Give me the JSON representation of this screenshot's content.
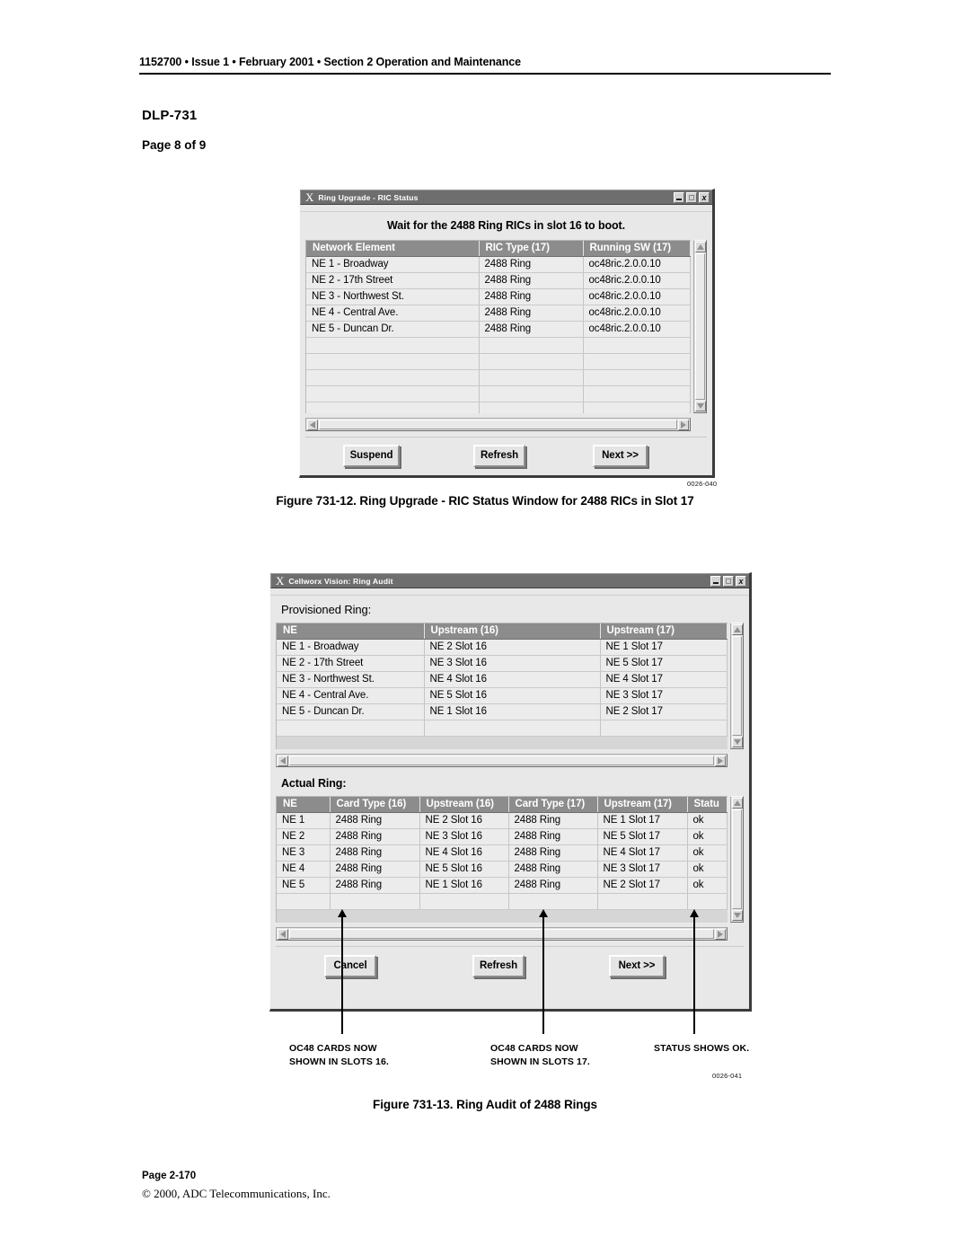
{
  "page": {
    "header": "1152700 • Issue 1 • February 2001 • Section 2 Operation and Maintenance",
    "dlp_title": "DLP-731",
    "dlp_page": "Page 8 of 9",
    "footer_page": "Page 2-170",
    "footer_copyright": "© 2000, ADC Telecommunications, Inc."
  },
  "figure1": {
    "id": "0026-040",
    "caption": "Figure 731-12. Ring Upgrade - RIC Status Window for 2488 RICs in Slot 17",
    "window": {
      "title": "Ring Upgrade - RIC Status",
      "title_icon": "X",
      "controls": {
        "minimize": "minimize-icon",
        "maximize": "maximize-icon",
        "close": "x"
      },
      "notice": "Wait for the 2488 Ring RICs in slot 16 to boot.",
      "table": {
        "columns": [
          "Network Element",
          "RIC Type (17)",
          "Running SW (17)"
        ],
        "rows": [
          [
            "NE 1 - Broadway",
            "2488 Ring",
            "oc48ric.2.0.0.10"
          ],
          [
            "NE 2 - 17th Street",
            "2488 Ring",
            "oc48ric.2.0.0.10"
          ],
          [
            "NE 3 - Northwest St.",
            "2488 Ring",
            "oc48ric.2.0.0.10"
          ],
          [
            "NE 4 - Central Ave.",
            "2488 Ring",
            "oc48ric.2.0.0.10"
          ],
          [
            "NE 5 - Duncan Dr.",
            "2488 Ring",
            "oc48ric.2.0.0.10"
          ]
        ],
        "empty_rows": 5
      },
      "buttons": {
        "suspend": "Suspend",
        "refresh": "Refresh",
        "next": "Next >>"
      }
    }
  },
  "figure2": {
    "id": "0026-041",
    "caption": "Figure 731-13. Ring Audit of 2488 Rings",
    "window": {
      "title": "Cellworx Vision: Ring Audit",
      "title_icon": "X",
      "controls": {
        "minimize": "minimize-icon",
        "maximize": "maximize-icon",
        "close": "x"
      },
      "provisioned_label": "Provisioned Ring:",
      "provisioned_table": {
        "columns": [
          "NE",
          "Upstream (16)",
          "Upstream (17)"
        ],
        "rows": [
          [
            "NE 1 - Broadway",
            "NE 2 Slot 16",
            "NE 1 Slot 17"
          ],
          [
            "NE 2 - 17th Street",
            "NE 3 Slot 16",
            "NE 5  Slot 17"
          ],
          [
            "NE 3 - Northwest St.",
            "NE 4 Slot 16",
            "NE 4 Slot 17"
          ],
          [
            "NE 4 - Central Ave.",
            "NE 5 Slot 16",
            "NE 3 Slot 17"
          ],
          [
            "NE 5 - Duncan Dr.",
            "NE 1 Slot 16",
            "NE 2 Slot 17"
          ]
        ],
        "empty_rows": 1
      },
      "actual_label": "Actual Ring:",
      "actual_table": {
        "columns": [
          "NE",
          "Card Type (16)",
          "Upstream (16)",
          "Card Type (17)",
          "Upstream (17)",
          "Statu"
        ],
        "rows": [
          [
            "NE 1",
            "2488 Ring",
            "NE 2 Slot 16",
            "2488 Ring",
            "NE 1 Slot 17",
            "ok"
          ],
          [
            "NE 2",
            "2488 Ring",
            "NE 3 Slot 16",
            "2488 Ring",
            "NE 5  Slot 17",
            "ok"
          ],
          [
            "NE 3",
            "2488 Ring",
            "NE 4 Slot 16",
            "2488 Ring",
            "NE 4 Slot 17",
            "ok"
          ],
          [
            "NE 4",
            "2488 Ring",
            "NE 5 Slot 16",
            "2488 Ring",
            "NE 3 Slot 17",
            "ok"
          ],
          [
            "NE 5",
            "2488 Ring",
            "NE 1 Slot 16",
            "2488 Ring",
            "NE 2 Slot 17",
            "ok"
          ]
        ],
        "empty_rows": 1
      },
      "buttons": {
        "cancel": "Cancel",
        "refresh": "Refresh",
        "next": "Next >>"
      }
    },
    "callouts": [
      {
        "line1": "OC48 CARDS NOW",
        "line2": "SHOWN IN SLOTS 16."
      },
      {
        "line1": "OC48 CARDS NOW",
        "line2": "SHOWN IN SLOTS 17."
      },
      {
        "line1": "STATUS SHOWS OK.",
        "line2": ""
      }
    ]
  }
}
